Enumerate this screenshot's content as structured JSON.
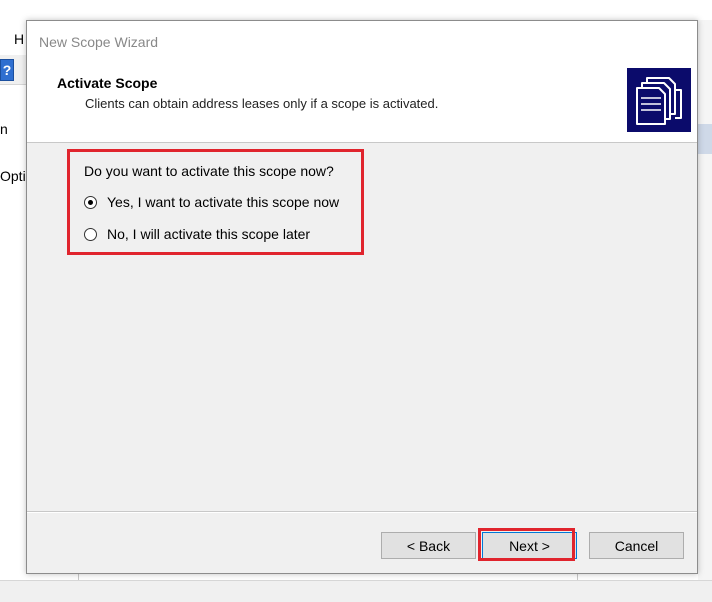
{
  "background": {
    "menu_fragment": "H",
    "help_glyph": "?",
    "tree_fragment_1": "n",
    "tree_fragment_2": "Optic"
  },
  "dialog": {
    "title": "New Scope Wizard",
    "header": {
      "title": "Activate Scope",
      "subtitle": "Clients can obtain address leases only if a scope is activated.",
      "image_icon": "folders-icon"
    },
    "question": "Do you want to activate this scope now?",
    "options": [
      {
        "label": "Yes, I want to activate this scope now",
        "selected": true
      },
      {
        "label": "No, I will activate this scope later",
        "selected": false
      }
    ],
    "buttons": {
      "back": "< Back",
      "next": "Next >",
      "cancel": "Cancel"
    },
    "colors": {
      "highlight": "#e0242d",
      "header_image_bg": "#0b0b6b"
    }
  }
}
